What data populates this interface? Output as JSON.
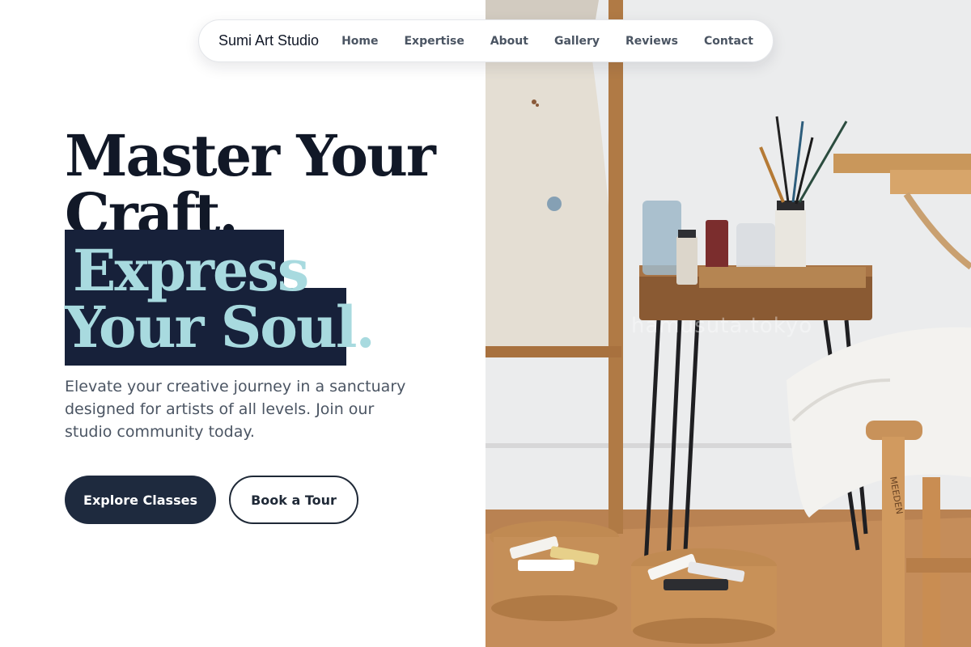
{
  "nav": {
    "brand": "Sumi Art Studio",
    "links": [
      "Home",
      "Expertise",
      "About",
      "Gallery",
      "Reviews",
      "Contact"
    ]
  },
  "hero": {
    "line1": "Master Your",
    "line2": "Craft.",
    "line3": "Express",
    "line4": "Your Soul.",
    "description": "Elevate your creative journey in a sanctuary designed for artists of all levels. Join our studio community today.",
    "primary_cta": "Explore Classes",
    "secondary_cta": "Book a Tour"
  },
  "photo": {
    "watermark": "hamusuta.tokyo",
    "easel_brand": "MEEDEN"
  },
  "colors": {
    "navy": "#1e2a3e",
    "heading": "#111827",
    "accent": "#a8dadf",
    "body_text": "#4b5563"
  }
}
